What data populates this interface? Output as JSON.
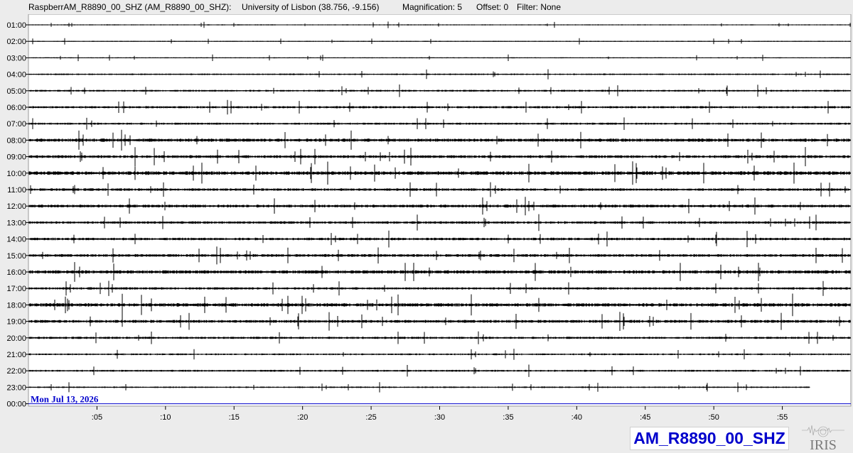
{
  "header": {
    "station": "RaspberrAM_R8890_00_SHZ (AM_R8890_00_SHZ):",
    "location": "University of Lisbon (38.756, -9.156)",
    "magnification": "Magnification: 5",
    "offset": "Offset: 0",
    "filter": "Filter: None"
  },
  "chart_data": {
    "type": "line",
    "title": "RaspberrAM_R8890_00_SHZ (AM_R8890_00_SHZ)",
    "date_label": "Mon Jul 13, 2026",
    "hour_labels": [
      "01:00",
      "02:00",
      "03:00",
      "04:00",
      "05:00",
      "06:00",
      "07:00",
      "08:00",
      "09:00",
      "10:00",
      "11:00",
      "12:00",
      "13:00",
      "14:00",
      "15:00",
      "16:00",
      "17:00",
      "18:00",
      "19:00",
      "20:00",
      "21:00",
      "22:00",
      "23:00",
      "00:00"
    ],
    "minute_ticks": [
      ":05",
      ":10",
      ":15",
      ":20",
      ":25",
      ":30",
      ":35",
      ":40",
      ":45",
      ":50",
      ":55"
    ],
    "minute_tick_values": [
      5,
      10,
      15,
      20,
      25,
      30,
      35,
      40,
      45,
      50,
      55
    ],
    "xlim": [
      0,
      60
    ],
    "trace_color": "#000000",
    "current_line_color": "#0000cc",
    "trace_end_minutes": [
      60,
      60,
      60,
      60,
      60,
      60,
      60,
      60,
      60,
      60,
      60,
      60,
      60,
      60,
      60,
      60,
      60,
      60,
      60,
      60,
      60,
      60,
      57,
      0
    ],
    "noise_level": [
      0.6,
      0.6,
      0.6,
      0.9,
      1.1,
      1.3,
      1.2,
      1.9,
      1.7,
      2.1,
      1.5,
      1.7,
      1.5,
      1.5,
      1.6,
      2.0,
      1.4,
      2.0,
      1.7,
      1.3,
      1.0,
      1.1,
      0.9,
      0
    ]
  },
  "footer": {
    "station_label": "AM_R8890_00_SHZ",
    "logo_text": "IRIS"
  },
  "colors": {
    "background": "#ececec",
    "plot_background": "#ffffff",
    "accent": "#0000cc"
  }
}
